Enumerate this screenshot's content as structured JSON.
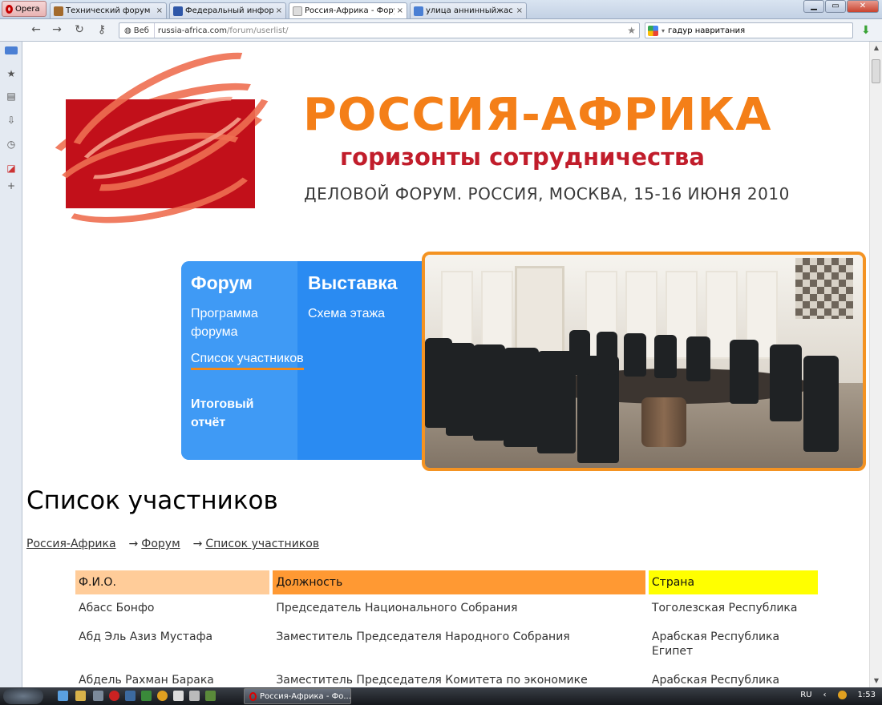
{
  "browser": {
    "menu_label": "Opera",
    "tabs": [
      {
        "label": "Технический форум",
        "color": "#a36a2c"
      },
      {
        "label": "Федеральный информа...",
        "color": "#2f57a8"
      },
      {
        "label": "Россия-Африка - Форум...",
        "color": "#dddddd",
        "active": true
      },
      {
        "label": "улица аннинныйжас к...",
        "color": "#4a7fd4"
      }
    ],
    "tab_close": "×",
    "address": {
      "chip": "Веб",
      "host": "russia-africa.com",
      "path": "/forum/userlist/"
    },
    "search_value": "гадур навритания"
  },
  "page": {
    "logo": {
      "title": "РОССИЯ-АФРИКА",
      "subtitle": "горизонты сотрудничества",
      "event": "ДЕЛОВОЙ ФОРУМ. РОССИЯ, МОСКВА, 15-16 ИЮНЯ 2010"
    },
    "nav": {
      "forum_heading": "Форум",
      "forum_items": [
        "Программа форума",
        "Список участников",
        "Итоговый отчёт"
      ],
      "expo_heading": "Выставка",
      "expo_items": [
        "Схема этажа"
      ]
    },
    "heading": "Список участников",
    "breadcrumb": [
      "Россия-Африка",
      "Форум",
      "Список участников"
    ],
    "breadcrumb_sep": "→",
    "table": {
      "headers": [
        {
          "label": "Ф.И.О.",
          "color": "#ffcc99"
        },
        {
          "label": "Должность",
          "color": "#ff9933"
        },
        {
          "label": "Страна",
          "color": "#ffff00"
        }
      ],
      "rows": [
        [
          "Абасс Бонфо",
          "Председатель Национального Собрания",
          "Тоголезская Республика"
        ],
        [
          "Абд Эль Азиз Мустафа",
          "Заместитель Председателя Народного Собрания",
          "Арабская Республика Египет"
        ],
        [
          "Абдель Рахман Барака",
          "Заместитель Председателя Комитета по экономике",
          "Арабская Республика"
        ]
      ]
    }
  },
  "taskbar": {
    "window_label": "Россия-Африка - Фо...",
    "language": "RU",
    "time": "1:53"
  }
}
